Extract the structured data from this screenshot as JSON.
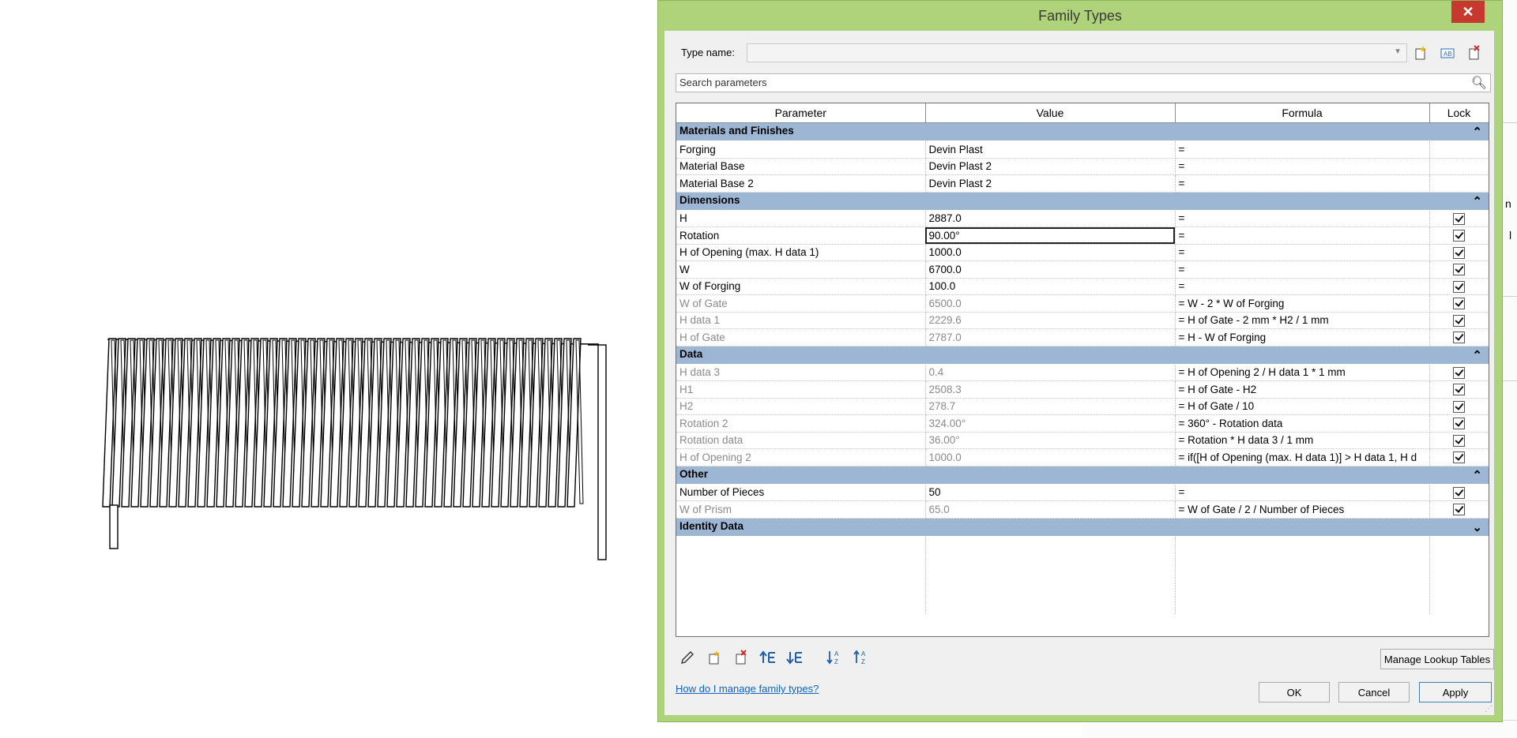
{
  "dialog": {
    "title": "Family Types",
    "type_name_label": "Type name:",
    "type_name_value": "",
    "search_placeholder": "Search parameters",
    "columns": [
      "Parameter",
      "Value",
      "Formula",
      "Lock"
    ],
    "help_link": "How do I manage family types?",
    "buttons": {
      "manage_lookup": "Manage Lookup Tables",
      "ok": "OK",
      "cancel": "Cancel",
      "apply": "Apply"
    },
    "icons": {
      "close": "close-icon",
      "new_type": "new-type-icon",
      "rename_type": "rename-type-icon",
      "delete_type": "delete-type-icon",
      "search": "search-icon",
      "edit_parameter": "pencil-icon",
      "new_parameter": "new-parameter-icon",
      "delete_parameter": "delete-parameter-icon",
      "move_up": "move-up-icon",
      "move_down": "move-down-icon",
      "sort_ascending": "sort-ascending-icon",
      "sort_descending": "sort-descending-icon"
    },
    "groups": [
      {
        "name": "Materials and Finishes",
        "expanded": true,
        "rows": [
          {
            "param": "Forging",
            "value": "Devin Plast",
            "formula": "=",
            "lock": null,
            "readonly": false
          },
          {
            "param": "Material Base",
            "value": "Devin Plast 2",
            "formula": "=",
            "lock": null,
            "readonly": false
          },
          {
            "param": "Material Base 2",
            "value": "Devin Plast 2",
            "formula": "=",
            "lock": null,
            "readonly": false
          }
        ]
      },
      {
        "name": "Dimensions",
        "expanded": true,
        "rows": [
          {
            "param": "H",
            "value": "2887.0",
            "formula": "=",
            "lock": true,
            "readonly": false
          },
          {
            "param": "Rotation",
            "value": "90.00°",
            "formula": "=",
            "lock": true,
            "readonly": false,
            "editing": true
          },
          {
            "param": "H of Opening (max. H data 1)",
            "value": "1000.0",
            "formula": "=",
            "lock": true,
            "readonly": false
          },
          {
            "param": "W",
            "value": "6700.0",
            "formula": "=",
            "lock": true,
            "readonly": false
          },
          {
            "param": "W of Forging",
            "value": "100.0",
            "formula": "=",
            "lock": true,
            "readonly": false
          },
          {
            "param": "W of Gate",
            "value": "6500.0",
            "formula": "= W - 2 * W of Forging",
            "lock": true,
            "readonly": true
          },
          {
            "param": "H data 1",
            "value": "2229.6",
            "formula": "= H of Gate - 2 mm * H2 / 1 mm",
            "lock": true,
            "readonly": true
          },
          {
            "param": "H of Gate",
            "value": "2787.0",
            "formula": "= H - W of Forging",
            "lock": true,
            "readonly": true
          }
        ]
      },
      {
        "name": "Data",
        "expanded": true,
        "rows": [
          {
            "param": "H data 3",
            "value": "0.4",
            "formula": "= H of Opening 2 / H data 1 * 1 mm",
            "lock": true,
            "readonly": true
          },
          {
            "param": "H1",
            "value": "2508.3",
            "formula": "= H of Gate - H2",
            "lock": true,
            "readonly": true
          },
          {
            "param": "H2",
            "value": "278.7",
            "formula": "= H of Gate / 10",
            "lock": true,
            "readonly": true
          },
          {
            "param": "Rotation 2",
            "value": "324.00°",
            "formula": "= 360° - Rotation data",
            "lock": true,
            "readonly": true
          },
          {
            "param": "Rotation data",
            "value": "36.00°",
            "formula": "= Rotation * H data 3 / 1 mm",
            "lock": true,
            "readonly": true
          },
          {
            "param": "H of Opening 2",
            "value": "1000.0",
            "formula": "= if([H of Opening (max. H data 1)] > H data 1, H d",
            "lock": true,
            "readonly": true
          }
        ]
      },
      {
        "name": "Other",
        "expanded": true,
        "rows": [
          {
            "param": "Number of Pieces",
            "value": "50",
            "formula": "=",
            "lock": true,
            "readonly": false
          },
          {
            "param": "W of Prism",
            "value": "65.0",
            "formula": "= W of Gate / 2 / Number of Pieces",
            "lock": true,
            "readonly": true
          }
        ]
      },
      {
        "name": "Identity Data",
        "expanded": false,
        "rows": []
      }
    ]
  },
  "background": {
    "edge_chars": [
      "n",
      "l"
    ]
  }
}
